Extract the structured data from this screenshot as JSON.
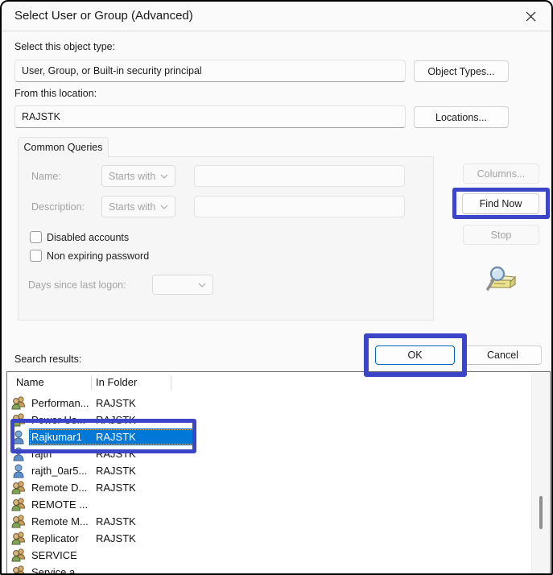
{
  "window": {
    "title": "Select User or Group (Advanced)"
  },
  "object_type": {
    "label": "Select this object type:",
    "value": "User, Group, or Built-in security principal",
    "button": "Object Types..."
  },
  "location": {
    "label": "From this location:",
    "value": "RAJSTK",
    "button": "Locations..."
  },
  "common_queries": {
    "tab_label": "Common Queries",
    "name_label": "Name:",
    "name_match": "Starts with",
    "name_value": "",
    "description_label": "Description:",
    "description_match": "Starts with",
    "description_value": "",
    "checkbox_disabled_accounts": "Disabled accounts",
    "checkbox_non_expiring": "Non expiring password",
    "days_label": "Days since last logon:",
    "days_value": "",
    "columns_button": "Columns...",
    "find_now_button": "Find Now",
    "stop_button": "Stop"
  },
  "actions": {
    "ok": "OK",
    "cancel": "Cancel"
  },
  "results": {
    "label": "Search results:",
    "columns": [
      "Name",
      "In Folder"
    ],
    "rows": [
      {
        "name": "Performan...",
        "folder": "RAJSTK",
        "type": "group",
        "selected": false
      },
      {
        "name": "Power Us...",
        "folder": "RAJSTK",
        "type": "group",
        "selected": false
      },
      {
        "name": "Rajkumar1",
        "folder": "RAJSTK",
        "type": "user",
        "selected": true
      },
      {
        "name": "rajth",
        "folder": "RAJSTK",
        "type": "user",
        "selected": false
      },
      {
        "name": "rajth_0ar5...",
        "folder": "RAJSTK",
        "type": "user",
        "selected": false
      },
      {
        "name": "Remote D...",
        "folder": "RAJSTK",
        "type": "group",
        "selected": false
      },
      {
        "name": "REMOTE ...",
        "folder": "",
        "type": "group",
        "selected": false
      },
      {
        "name": "Remote M...",
        "folder": "RAJSTK",
        "type": "group",
        "selected": false
      },
      {
        "name": "Replicator",
        "folder": "RAJSTK",
        "type": "group",
        "selected": false
      },
      {
        "name": "SERVICE",
        "folder": "",
        "type": "group",
        "selected": false
      },
      {
        "name": "Service a...",
        "folder": "",
        "type": "group",
        "selected": false
      }
    ]
  },
  "colors": {
    "annotation": "#3c45c8",
    "selection_bg": "#0078d7",
    "selection_text": "#ffffff"
  }
}
